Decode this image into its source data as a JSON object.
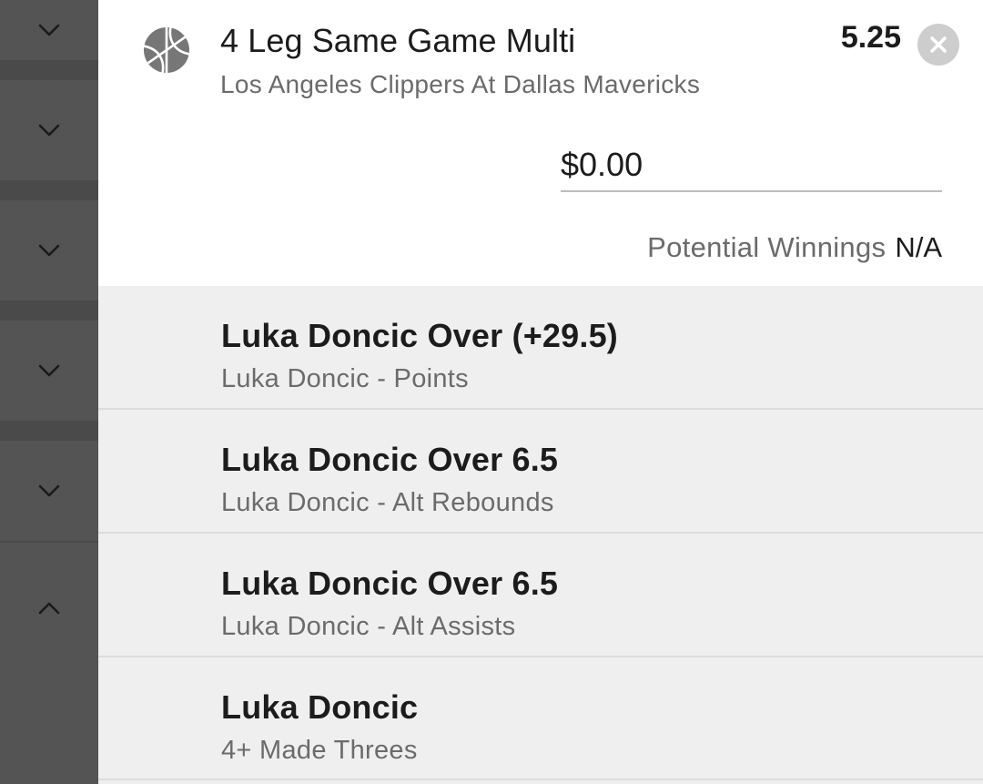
{
  "rail": {
    "icons": [
      "chevron-down",
      "chevron-down",
      "chevron-down",
      "chevron-down",
      "chevron-down",
      "chevron-up"
    ]
  },
  "bet": {
    "sport_icon": "basketball-icon",
    "title": "4 Leg Same Game Multi",
    "match": "Los Angeles Clippers At Dallas Mavericks",
    "odds": "5.25",
    "close_icon": "close-icon",
    "stake_value": "$0.00",
    "potential_winnings_label": "Potential Winnings",
    "potential_winnings_value": "N/A"
  },
  "legs": [
    {
      "title": "Luka Doncic Over (+29.5)",
      "market": "Luka Doncic - Points"
    },
    {
      "title": "Luka Doncic Over 6.5",
      "market": "Luka Doncic - Alt Rebounds"
    },
    {
      "title": "Luka Doncic Over 6.5",
      "market": "Luka Doncic - Alt Assists"
    },
    {
      "title": "Luka Doncic",
      "market": "4+ Made Threes"
    }
  ],
  "colors": {
    "rail": "#545454",
    "legs_bg": "#efeff0",
    "primary_text": "#1c1c1c",
    "secondary_text": "#6b6b6b"
  }
}
